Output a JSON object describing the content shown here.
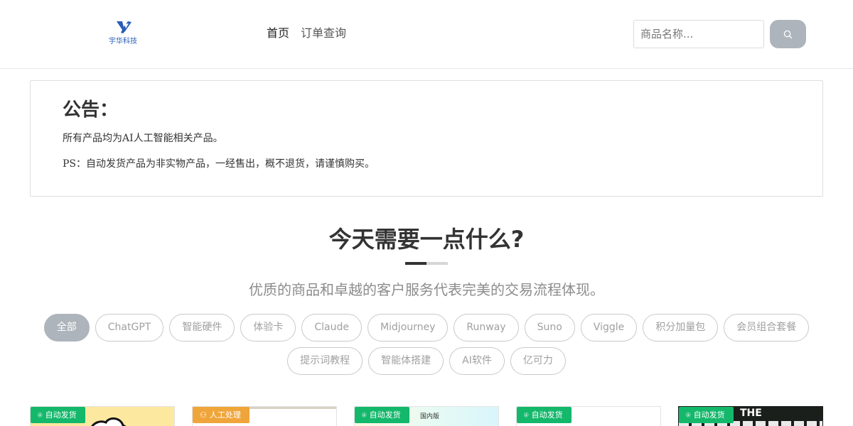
{
  "header": {
    "logo_text": "宇华科技",
    "nav": [
      {
        "label": "首页",
        "active": true
      },
      {
        "label": "订单查询",
        "active": false
      }
    ],
    "search_placeholder": "商品名称...",
    "search_icon": "search-icon"
  },
  "notice": {
    "title": "公告：",
    "line1": "所有产品均为AI人工智能相关产品。",
    "line2": "PS：自动发货产品为非实物产品，一经售出，概不退货，请谨慎购买。"
  },
  "section": {
    "title": "今天需要一点什么?",
    "subtitle": "优质的商品和卓越的客户服务代表完美的交易流程体现。"
  },
  "categories": [
    {
      "label": "全部",
      "active": true
    },
    {
      "label": "ChatGPT",
      "active": false
    },
    {
      "label": "智能硬件",
      "active": false
    },
    {
      "label": "体验卡",
      "active": false
    },
    {
      "label": "Claude",
      "active": false
    },
    {
      "label": "Midjourney",
      "active": false
    },
    {
      "label": "Runway",
      "active": false
    },
    {
      "label": "Suno",
      "active": false
    },
    {
      "label": "Viggle",
      "active": false
    },
    {
      "label": "积分加量包",
      "active": false
    },
    {
      "label": "会员组合套餐",
      "active": false
    },
    {
      "label": "提示词教程",
      "active": false
    },
    {
      "label": "智能体搭建",
      "active": false
    },
    {
      "label": "AI软件",
      "active": false
    },
    {
      "label": "亿可力",
      "active": false
    }
  ],
  "products": [
    {
      "badge": "自动发货",
      "badge_type": "auto",
      "badge_icon": "gift-icon",
      "thumb_color": "#fde8a0",
      "thumb_text": ""
    },
    {
      "badge": "人工处理",
      "badge_type": "manual",
      "badge_icon": "person-icon",
      "thumb_color": "#e9e4da",
      "thumb_text": ""
    },
    {
      "badge": "自动发货",
      "badge_type": "auto",
      "badge_icon": "gift-icon",
      "thumb_color": "#eef8e8",
      "thumb_text": "国内版"
    },
    {
      "badge": "自动发货",
      "badge_type": "auto",
      "badge_icon": "gift-icon",
      "thumb_color": "#ffffff",
      "thumb_text": ""
    },
    {
      "badge": "自动发货",
      "badge_type": "auto",
      "badge_icon": "gift-icon",
      "thumb_color": "#1a1f1c",
      "thumb_text": "THE"
    }
  ],
  "colors": {
    "accent_gray": "#aeb4bc",
    "auto_badge": "#14b86b",
    "manual_badge": "#f0a53a",
    "logo_blue": "#2a5cb8"
  }
}
